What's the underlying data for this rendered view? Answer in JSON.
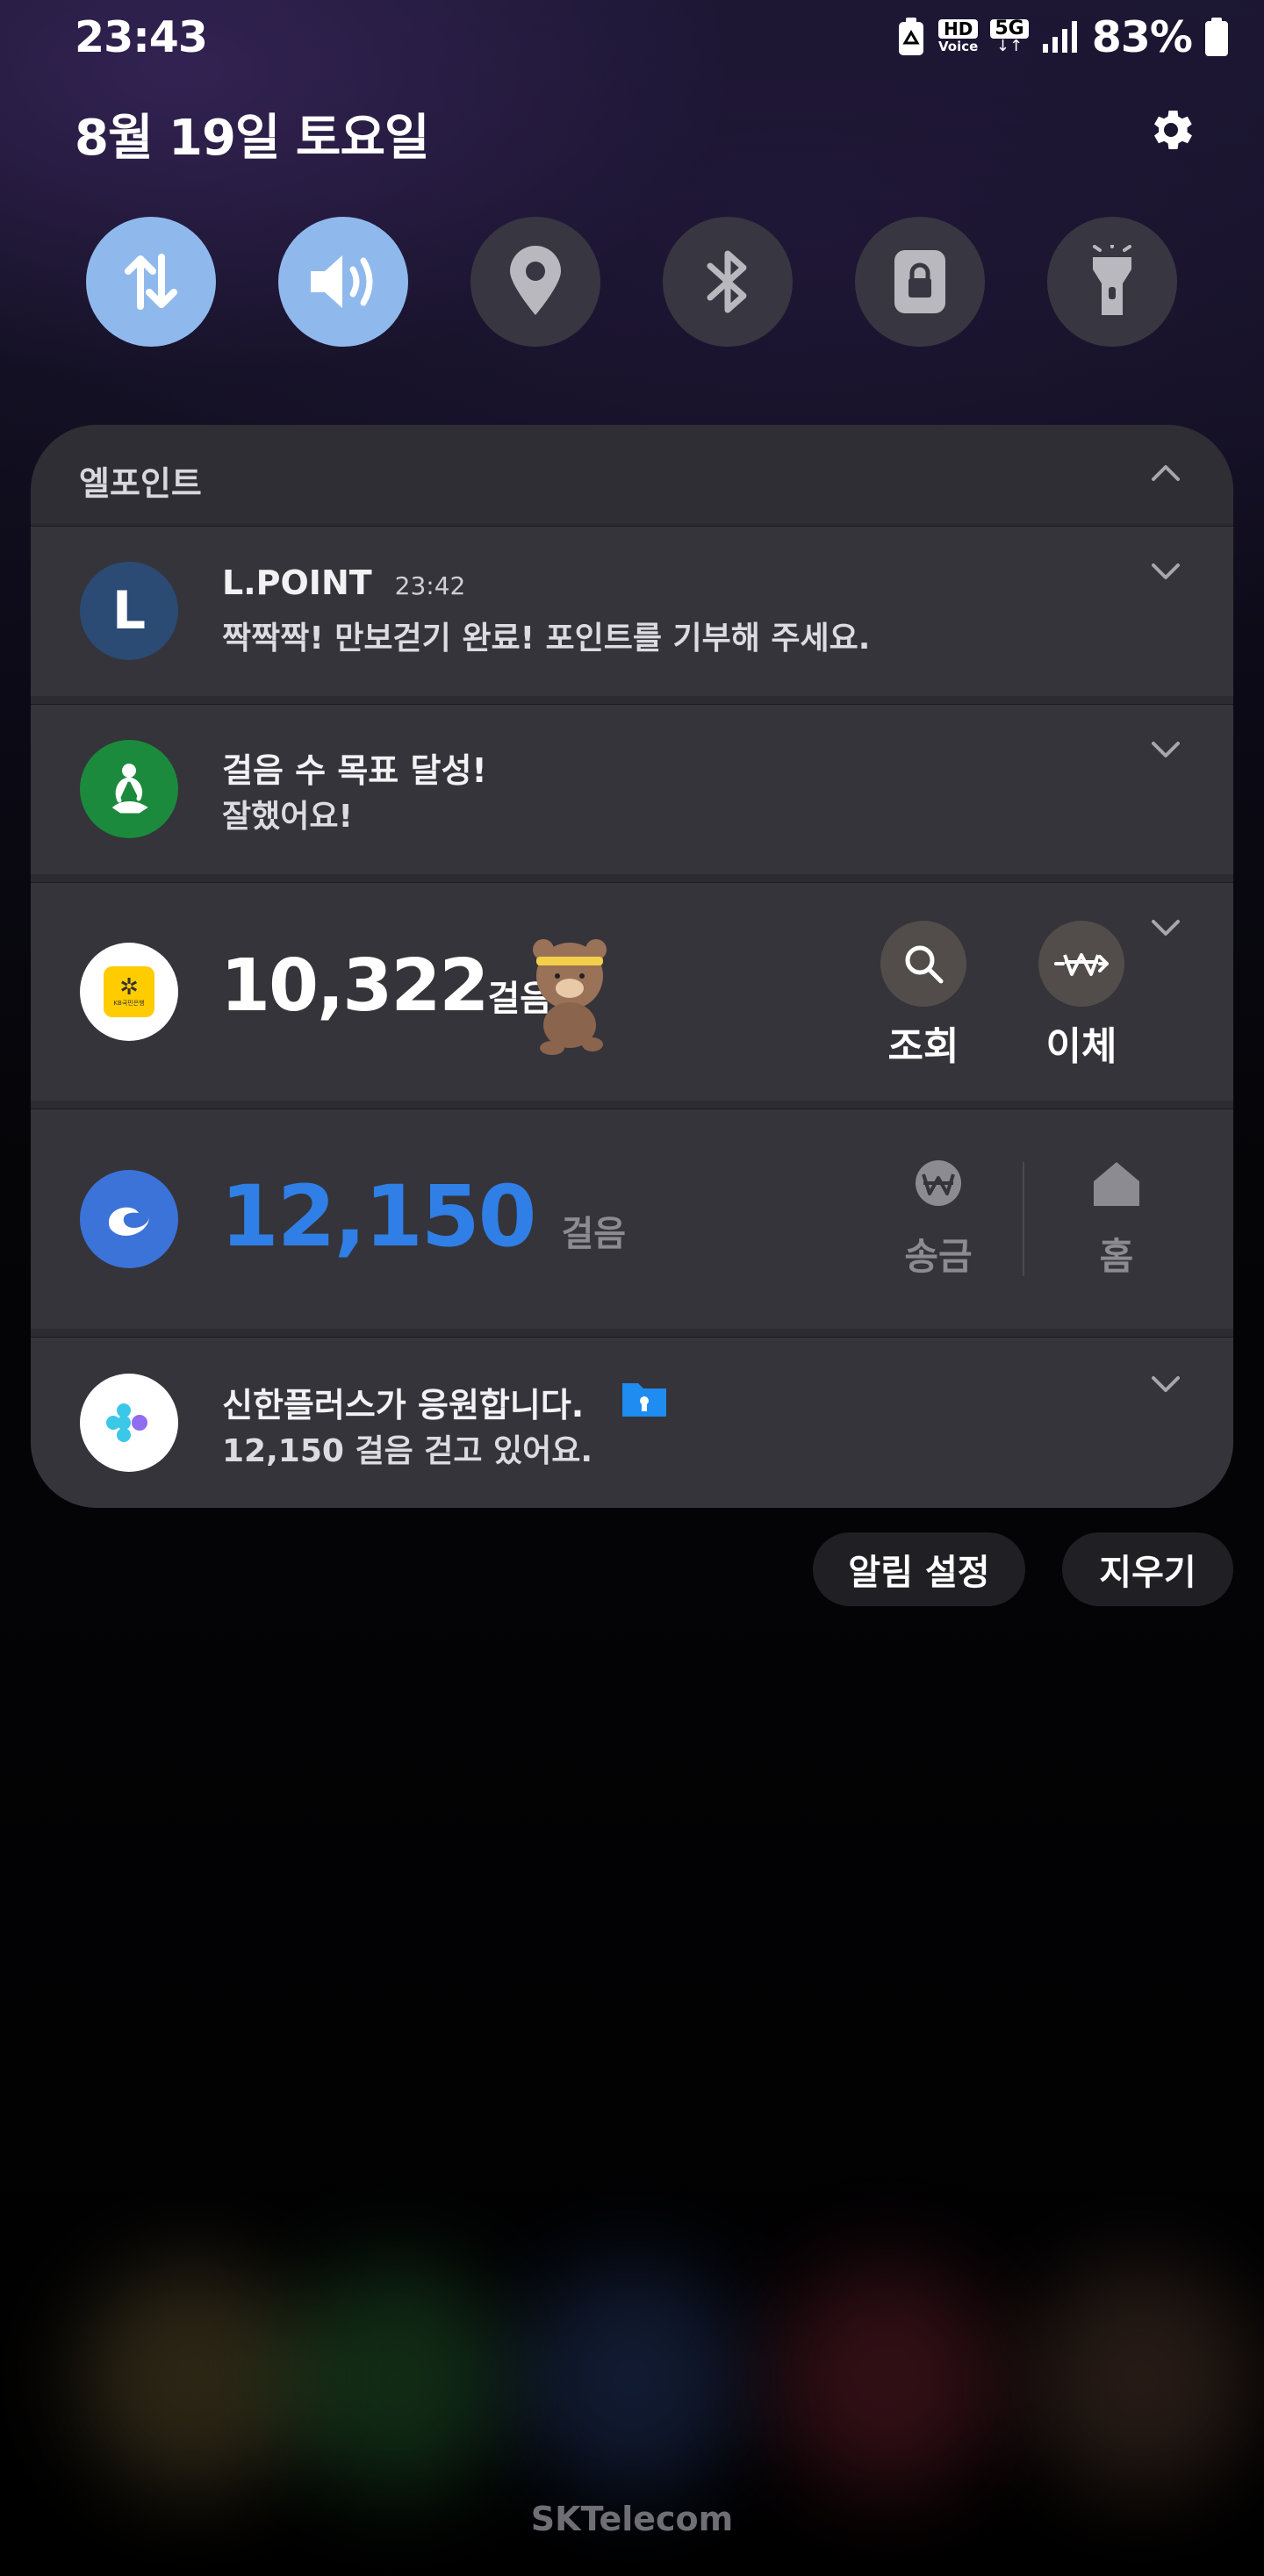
{
  "status_bar": {
    "time": "23:43",
    "hd_voice_top": "HD",
    "hd_voice_bottom": "Voice",
    "network": "5G",
    "battery": "83%",
    "icons": [
      "recycle-battery-icon",
      "hd-voice-icon",
      "5g-icon",
      "signal-icon",
      "battery-icon"
    ]
  },
  "header": {
    "date": "8월 19일 토요일",
    "settings_icon": "gear-icon"
  },
  "quick_settings": [
    {
      "name": "mobile-data",
      "icon": "arrows-updown-icon",
      "state": "on"
    },
    {
      "name": "sound",
      "icon": "speaker-icon",
      "state": "on"
    },
    {
      "name": "location",
      "icon": "location-pin-icon",
      "state": "off"
    },
    {
      "name": "bluetooth",
      "icon": "bluetooth-icon",
      "state": "off"
    },
    {
      "name": "lock",
      "icon": "lock-icon",
      "state": "off"
    },
    {
      "name": "flashlight",
      "icon": "flashlight-icon",
      "state": "off"
    }
  ],
  "notification_group": {
    "title": "엘포인트",
    "cards": {
      "lpoint": {
        "avatar_letter": "L",
        "app": "L.POINT",
        "time": "23:42",
        "message": "짝짝짝! 만보걷기 완료! 포인트를 기부해 주세요."
      },
      "goal": {
        "title": "걸음 수 목표 달성!",
        "message": "잘했어요!"
      },
      "kb": {
        "logo_text": "KB국민은행",
        "steps": "10,322",
        "unit": "걸음",
        "actions": [
          {
            "label": "조회",
            "icon": "search-icon"
          },
          {
            "label": "이체",
            "icon": "won-transfer-icon"
          }
        ]
      },
      "shinhan": {
        "steps": "12,150",
        "unit": "걸음",
        "actions": [
          {
            "label": "송금",
            "icon": "won-icon"
          },
          {
            "label": "홈",
            "icon": "home-icon"
          }
        ]
      },
      "shinhan_plus": {
        "title": "신한플러스가 응원합니다.",
        "message": "12,150 걸음 걷고 있어요."
      }
    }
  },
  "buttons": {
    "notification_settings": "알림 설정",
    "clear": "지우기"
  },
  "carrier": "SKTelecom",
  "colors": {
    "accent_blue": "#2f7fe6",
    "quick_on": "#8fb9ec",
    "quick_off": "#383741",
    "card_bg": "#35343a",
    "lpoint_avatar": "#2b4a74",
    "goal_green": "#1b8a3c",
    "shinhan_blue": "#3b73d8"
  }
}
